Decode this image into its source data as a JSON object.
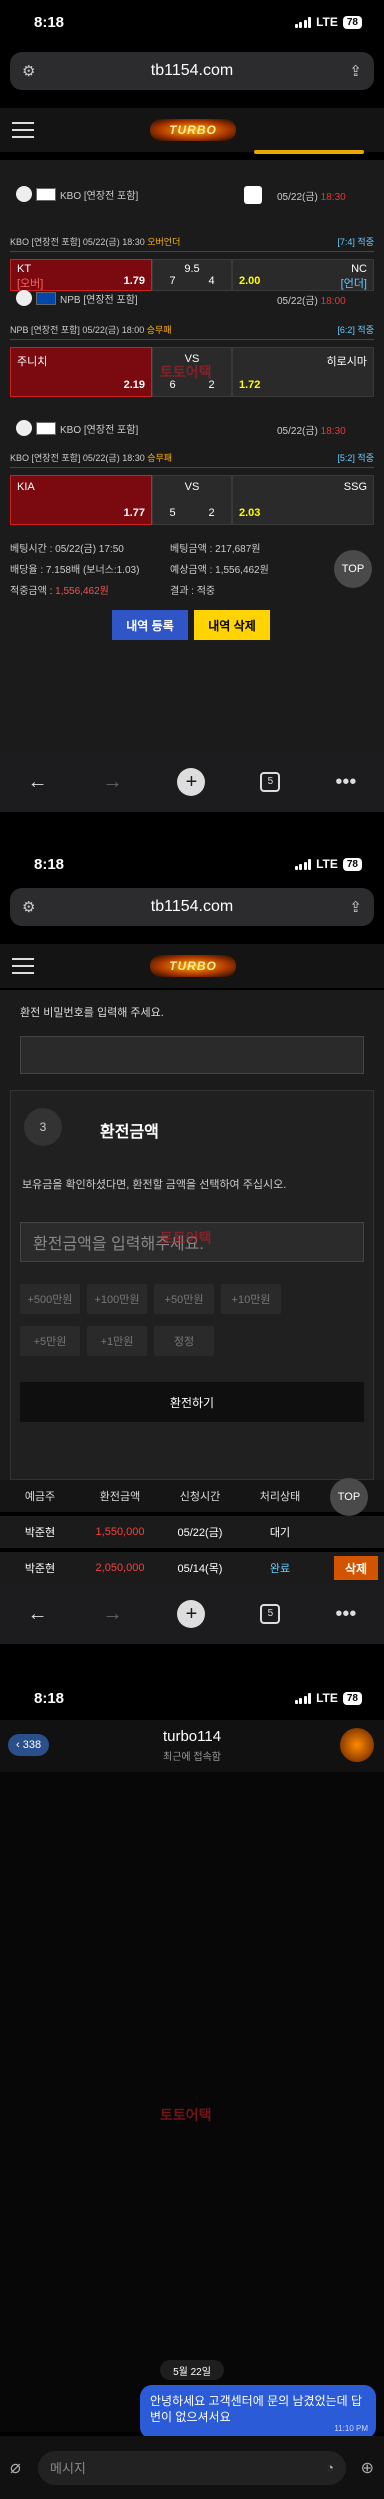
{
  "status": {
    "time": "8:18",
    "network": "LTE",
    "battery": "78"
  },
  "browser": {
    "url": "tb1154.com",
    "tab_count": "5"
  },
  "site": {
    "logo": "TURBO"
  },
  "games": [
    {
      "league": "KBO [연장전 포함]",
      "date": "05/22(금)",
      "time": "18:30"
    },
    {
      "league": "NPB [연장전 포함]",
      "date": "05/22(금)",
      "time": "18:00"
    },
    {
      "league": "KBO [연장전 포함]",
      "date": "05/22(금)",
      "time": "18:30"
    }
  ],
  "bets": [
    {
      "info": "KBO [연장전 포함] 05/22(금) 18:30",
      "type": "오버언더",
      "result": "[7:4] 적중",
      "home": "KT",
      "home_tag": "[오버]",
      "home_odds": "1.79",
      "mid": "9.5",
      "home_score": "7",
      "away_score": "4",
      "away_odds": "2.00",
      "away_tag": "[언더]",
      "away": "NC"
    },
    {
      "info": "NPB [연장전 포함] 05/22(금) 18:00",
      "type": "승무패",
      "result": "[6:2] 적중",
      "home": "주니치",
      "home_odds": "2.19",
      "mid": "VS",
      "home_score": "6",
      "away_score": "2",
      "away_odds": "1.72",
      "away": "히로시마"
    },
    {
      "info": "KBO [연장전 포함] 05/22(금) 18:30",
      "type": "승무패",
      "result": "[5:2] 적중",
      "home": "KIA",
      "home_odds": "1.77",
      "mid": "VS",
      "home_score": "5",
      "away_score": "2",
      "away_odds": "2.03",
      "away": "SSG"
    }
  ],
  "summary": {
    "bet_time": "베팅시간 : 05/22(금) 17:50",
    "bet_amount": "베팅금액 : 217,687원",
    "bet_odds": "배당율 : 7.158배 (보너스:1.03)",
    "expected": "예상금액 : 1,556,462원",
    "win_label": "적중금액 : ",
    "win_amount": "1,556,462원",
    "result": "결과 : 적중",
    "btn_register": "내역 등록",
    "btn_delete": "내역 삭제",
    "top": "TOP"
  },
  "exchange": {
    "pw_prompt": "환전 비밀번호를 입력해 주세요.",
    "step": "3",
    "title": "환전금액",
    "desc": "보유금을 확인하셨다면, 환전할 금액을 선택하여 주십시오.",
    "amount_placeholder": "환전금액을 입력해주세요.",
    "chips_row1": [
      "+500만원",
      "+100만원",
      "+50만원",
      "+10만원"
    ],
    "chips_row2": [
      "+5만원",
      "+1만원",
      "정정"
    ],
    "submit": "환전하기",
    "table_headers": [
      "예금주",
      "환전금액",
      "신청시간",
      "처리상태"
    ],
    "rows": [
      {
        "name": "박준현",
        "amount": "1,550,000",
        "date": "05/22(금)",
        "status": "대기",
        "action": ""
      },
      {
        "name": "박준현",
        "amount": "2,050,000",
        "date": "05/14(목)",
        "status": "완료",
        "action": "삭제"
      }
    ],
    "top": "TOP"
  },
  "chat": {
    "back_count": "338",
    "name": "turbo114",
    "subtitle": "최근에 접속함",
    "date": "5월 22일",
    "message": "안녕하세요 고객센터에 문의 남겼었는데 답변이 없으셔서요",
    "msg_time": "11:10 PM",
    "input_placeholder": "메시지"
  },
  "watermark": "토토어택"
}
